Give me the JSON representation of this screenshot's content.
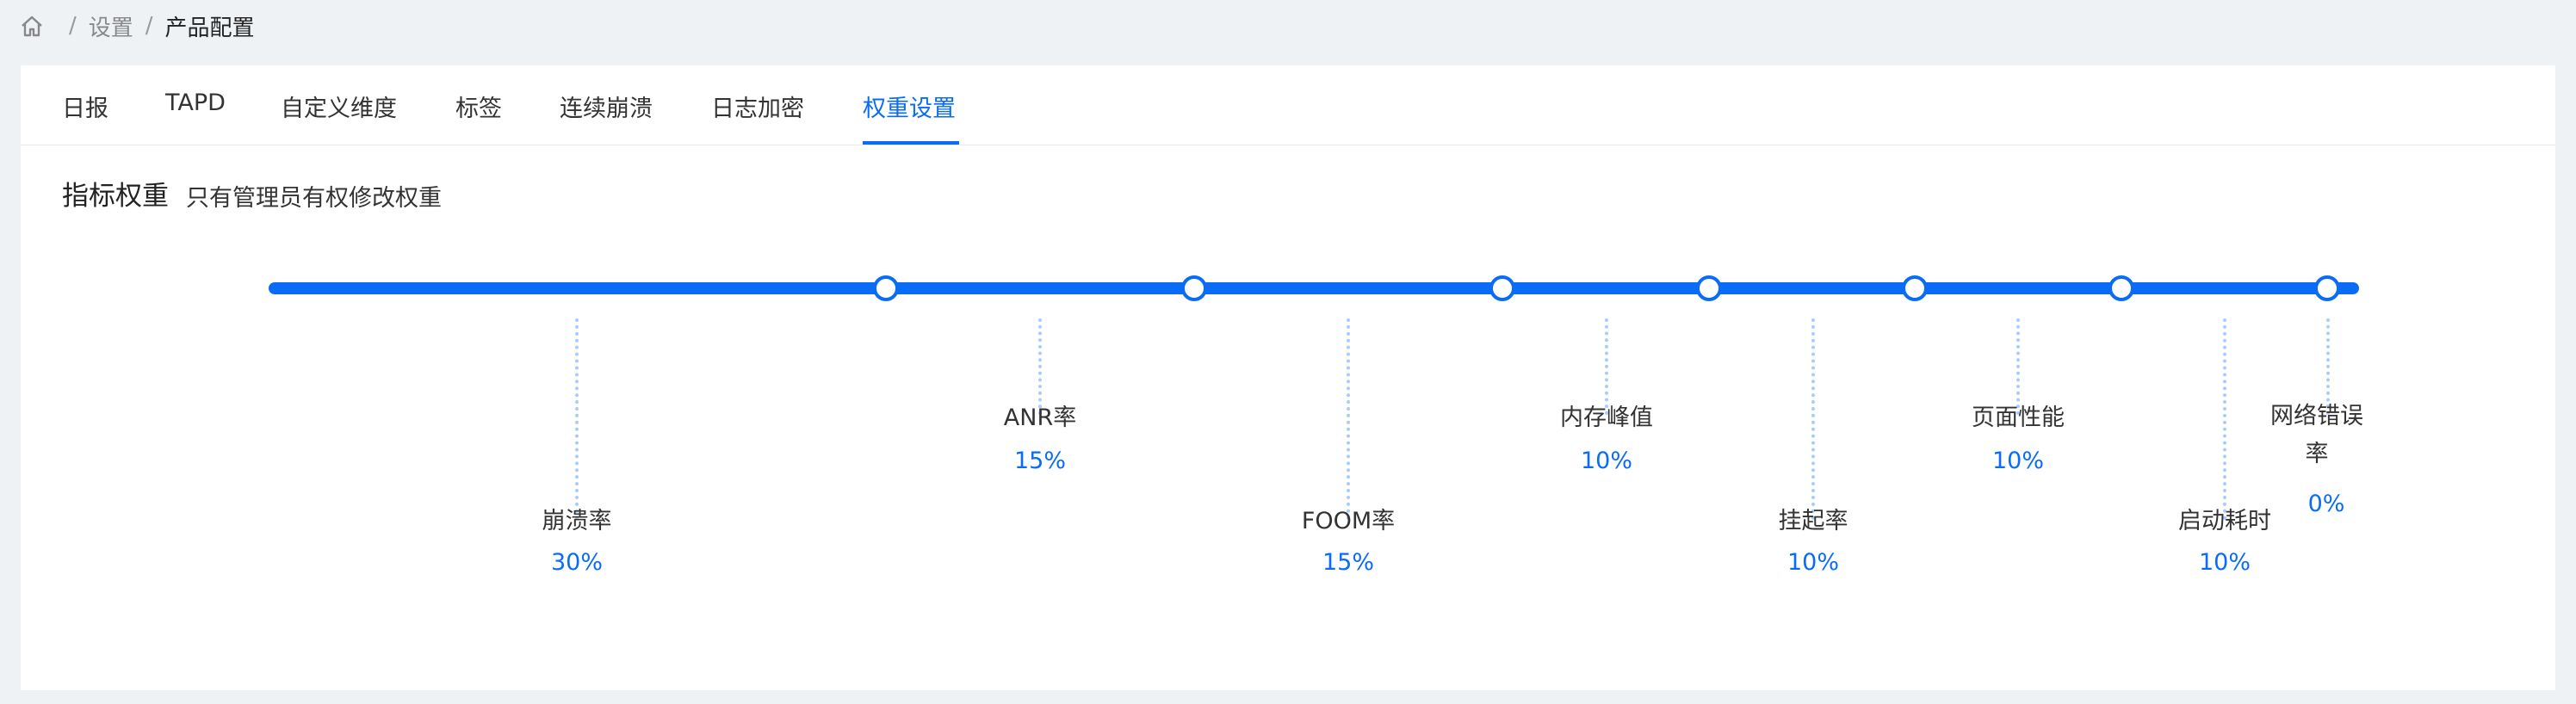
{
  "breadcrumb": {
    "items": [
      "设置",
      "产品配置"
    ],
    "separator": "/"
  },
  "tabs": [
    {
      "label": "日报"
    },
    {
      "label": "TAPD"
    },
    {
      "label": "自定义维度"
    },
    {
      "label": "标签"
    },
    {
      "label": "连续崩溃"
    },
    {
      "label": "日志加密"
    },
    {
      "label": "权重设置",
      "active": true
    }
  ],
  "section": {
    "title": "指标权重",
    "note": "只有管理员有权修改权重"
  },
  "weights": [
    {
      "label": "崩溃率",
      "value": "30%"
    },
    {
      "label": "ANR率",
      "value": "15%"
    },
    {
      "label": "FOOM率",
      "value": "15%"
    },
    {
      "label": "内存峰值",
      "value": "10%"
    },
    {
      "label": "挂起率",
      "value": "10%"
    },
    {
      "label": "页面性能",
      "value": "10%"
    },
    {
      "label": "启动耗时",
      "value": "10%"
    },
    {
      "label": "网络错误率",
      "value": "0%"
    }
  ],
  "colors": {
    "accent": "#0a6cf5",
    "bg": "#eff2f5"
  }
}
